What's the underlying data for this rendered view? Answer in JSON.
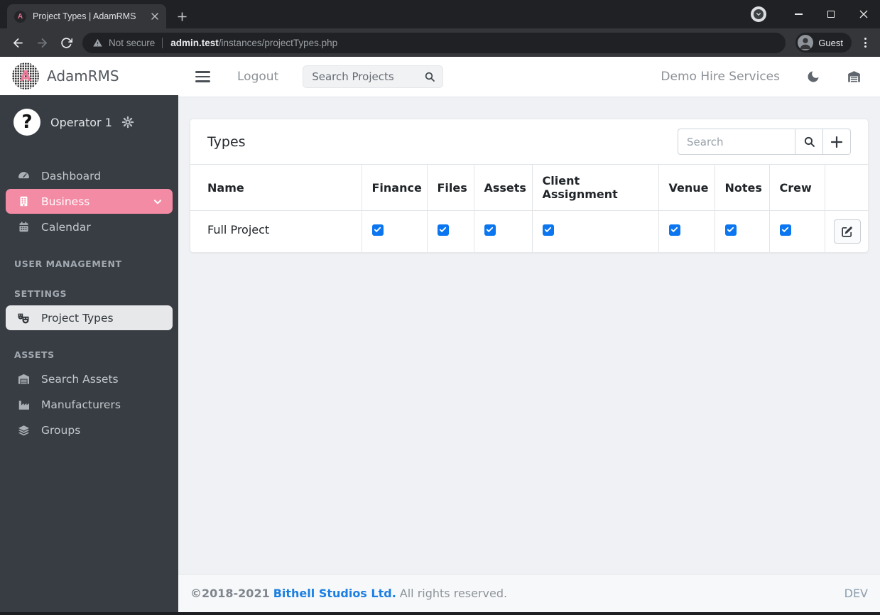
{
  "colors": {
    "accent_pink": "#f48ba4",
    "checkbox_blue": "#0b76ef",
    "link_blue": "#1b7fe3"
  },
  "browser": {
    "tab_title": "Project Types | AdamRMS",
    "favicon_letter": "A",
    "security_label": "Not secure",
    "url_host": "admin.test",
    "url_path": "/instances/projectTypes.php",
    "profile_label": "Guest"
  },
  "sidebar": {
    "brand": "AdamRMS",
    "user": {
      "name": "Operator 1",
      "avatar_letter": "?"
    },
    "sections": [
      {
        "label": "USER MANAGEMENT"
      },
      {
        "label": "SETTINGS"
      },
      {
        "label": "ASSETS"
      }
    ],
    "items": [
      {
        "label": "Dashboard"
      },
      {
        "label": "Business"
      },
      {
        "label": "Calendar"
      },
      {
        "label": "Project Types"
      },
      {
        "label": "Search Assets"
      },
      {
        "label": "Manufacturers"
      },
      {
        "label": "Groups"
      }
    ]
  },
  "topbar": {
    "logout_label": "Logout",
    "search_placeholder": "Search Projects",
    "instance_name": "Demo Hire Services"
  },
  "main": {
    "card": {
      "title": "Types",
      "search_placeholder": "Search",
      "table": {
        "columns": [
          "Name",
          "Finance",
          "Files",
          "Assets",
          "Client Assignment",
          "Venue",
          "Notes",
          "Crew",
          ""
        ],
        "rows": [
          {
            "name": "Full Project",
            "checks": [
              true,
              true,
              true,
              true,
              true,
              true,
              true
            ]
          }
        ]
      }
    }
  },
  "footer": {
    "copyright": "©2018-2021",
    "company_link": "Bithell Studios Ltd.",
    "rights": "All rights reserved.",
    "env_label": "DEV"
  }
}
